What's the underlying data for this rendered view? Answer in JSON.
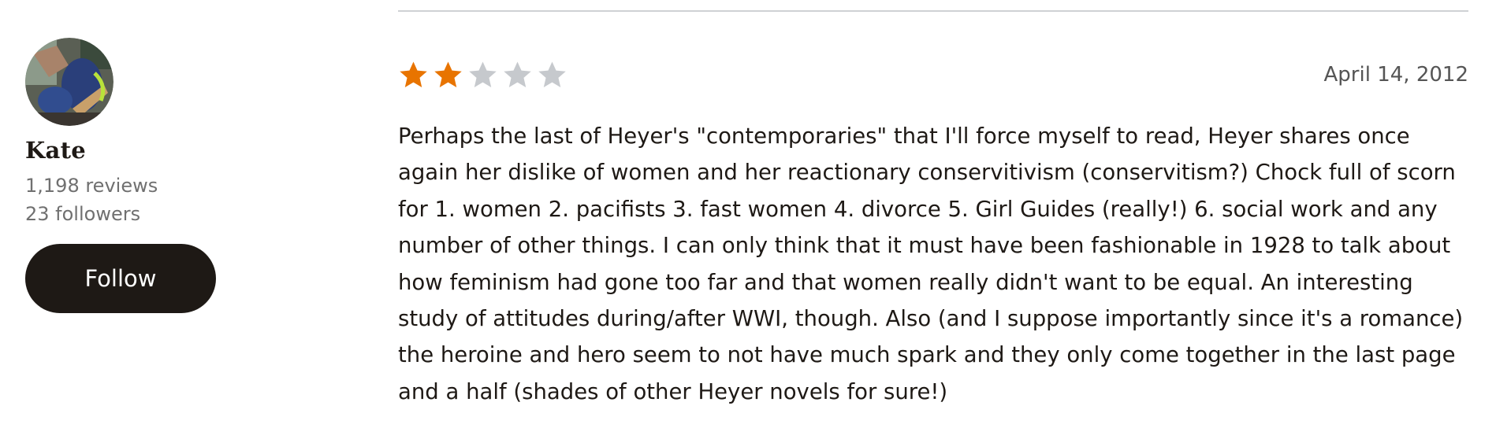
{
  "reviewer": {
    "name": "Kate",
    "reviews": "1,198 reviews",
    "followers": "23 followers",
    "follow_label": "Follow",
    "avatar_icon": "avatar-photo"
  },
  "review": {
    "rating": 2,
    "max_rating": 5,
    "star_filled_color": "#e87400",
    "star_empty_color": "#c6c9cd",
    "date": "April 14, 2012",
    "text": "Perhaps the last of Heyer's \"contemporaries\" that I'll force myself to read, Heyer shares once again her dislike of women and her reactionary conservitivism (conservitism?) Chock full of scorn for 1. women 2. pacifists 3. fast women 4. divorce 5. Girl Guides (really!) 6. social work and any number of other things. I can only think that it must have been fashionable in 1928 to talk about how feminism had gone too far and that women really didn't want to be equal. An interesting study of attitudes during/after WWI, though. Also (and I suppose importantly since it's a romance) the heroine and hero seem to not have much spark and they only come together in the last page and a half (shades of other Heyer novels for sure!)"
  }
}
